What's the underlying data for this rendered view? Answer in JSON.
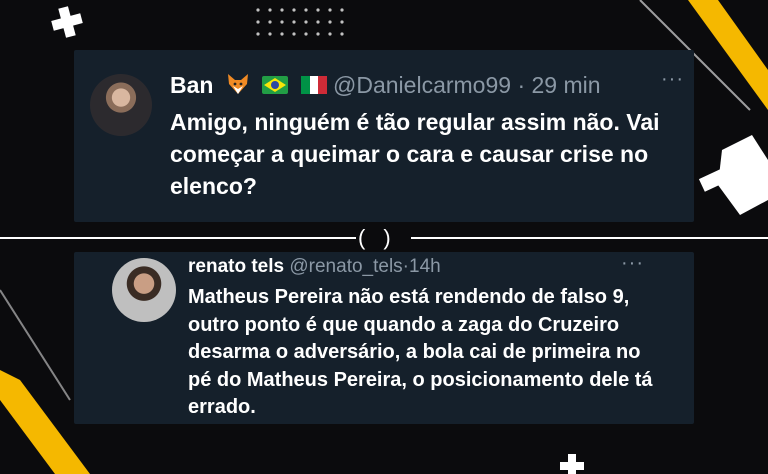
{
  "tweets": [
    {
      "display_name": "Ban",
      "emoji_icons": [
        "fox-emoji",
        "brazil-flag",
        "italy-flag"
      ],
      "handle": "@Danielcarmo99",
      "separator": "·",
      "time": "29 min",
      "text": "Amigo, ninguém é tão regular assim não. Vai começar a queimar o cara e causar crise no elenco?",
      "more": "···"
    },
    {
      "display_name": "renato tels",
      "handle": "@renato_tels",
      "separator": "·",
      "time": "14h",
      "text": "Matheus Pereira não está rendendo de falso 9, outro ponto é que quando a zaga do Cruzeiro desarma o adversário, a bola cai de primeira no pé do Matheus Pereira, o posicionamento dele tá errado.",
      "more": "···"
    }
  ],
  "divider_label": "()",
  "colors": {
    "background": "#0b0b0d",
    "card": "#15202b",
    "accent_yellow": "#f5b800",
    "text_primary": "#ffffff",
    "text_secondary": "#8b98a5"
  }
}
